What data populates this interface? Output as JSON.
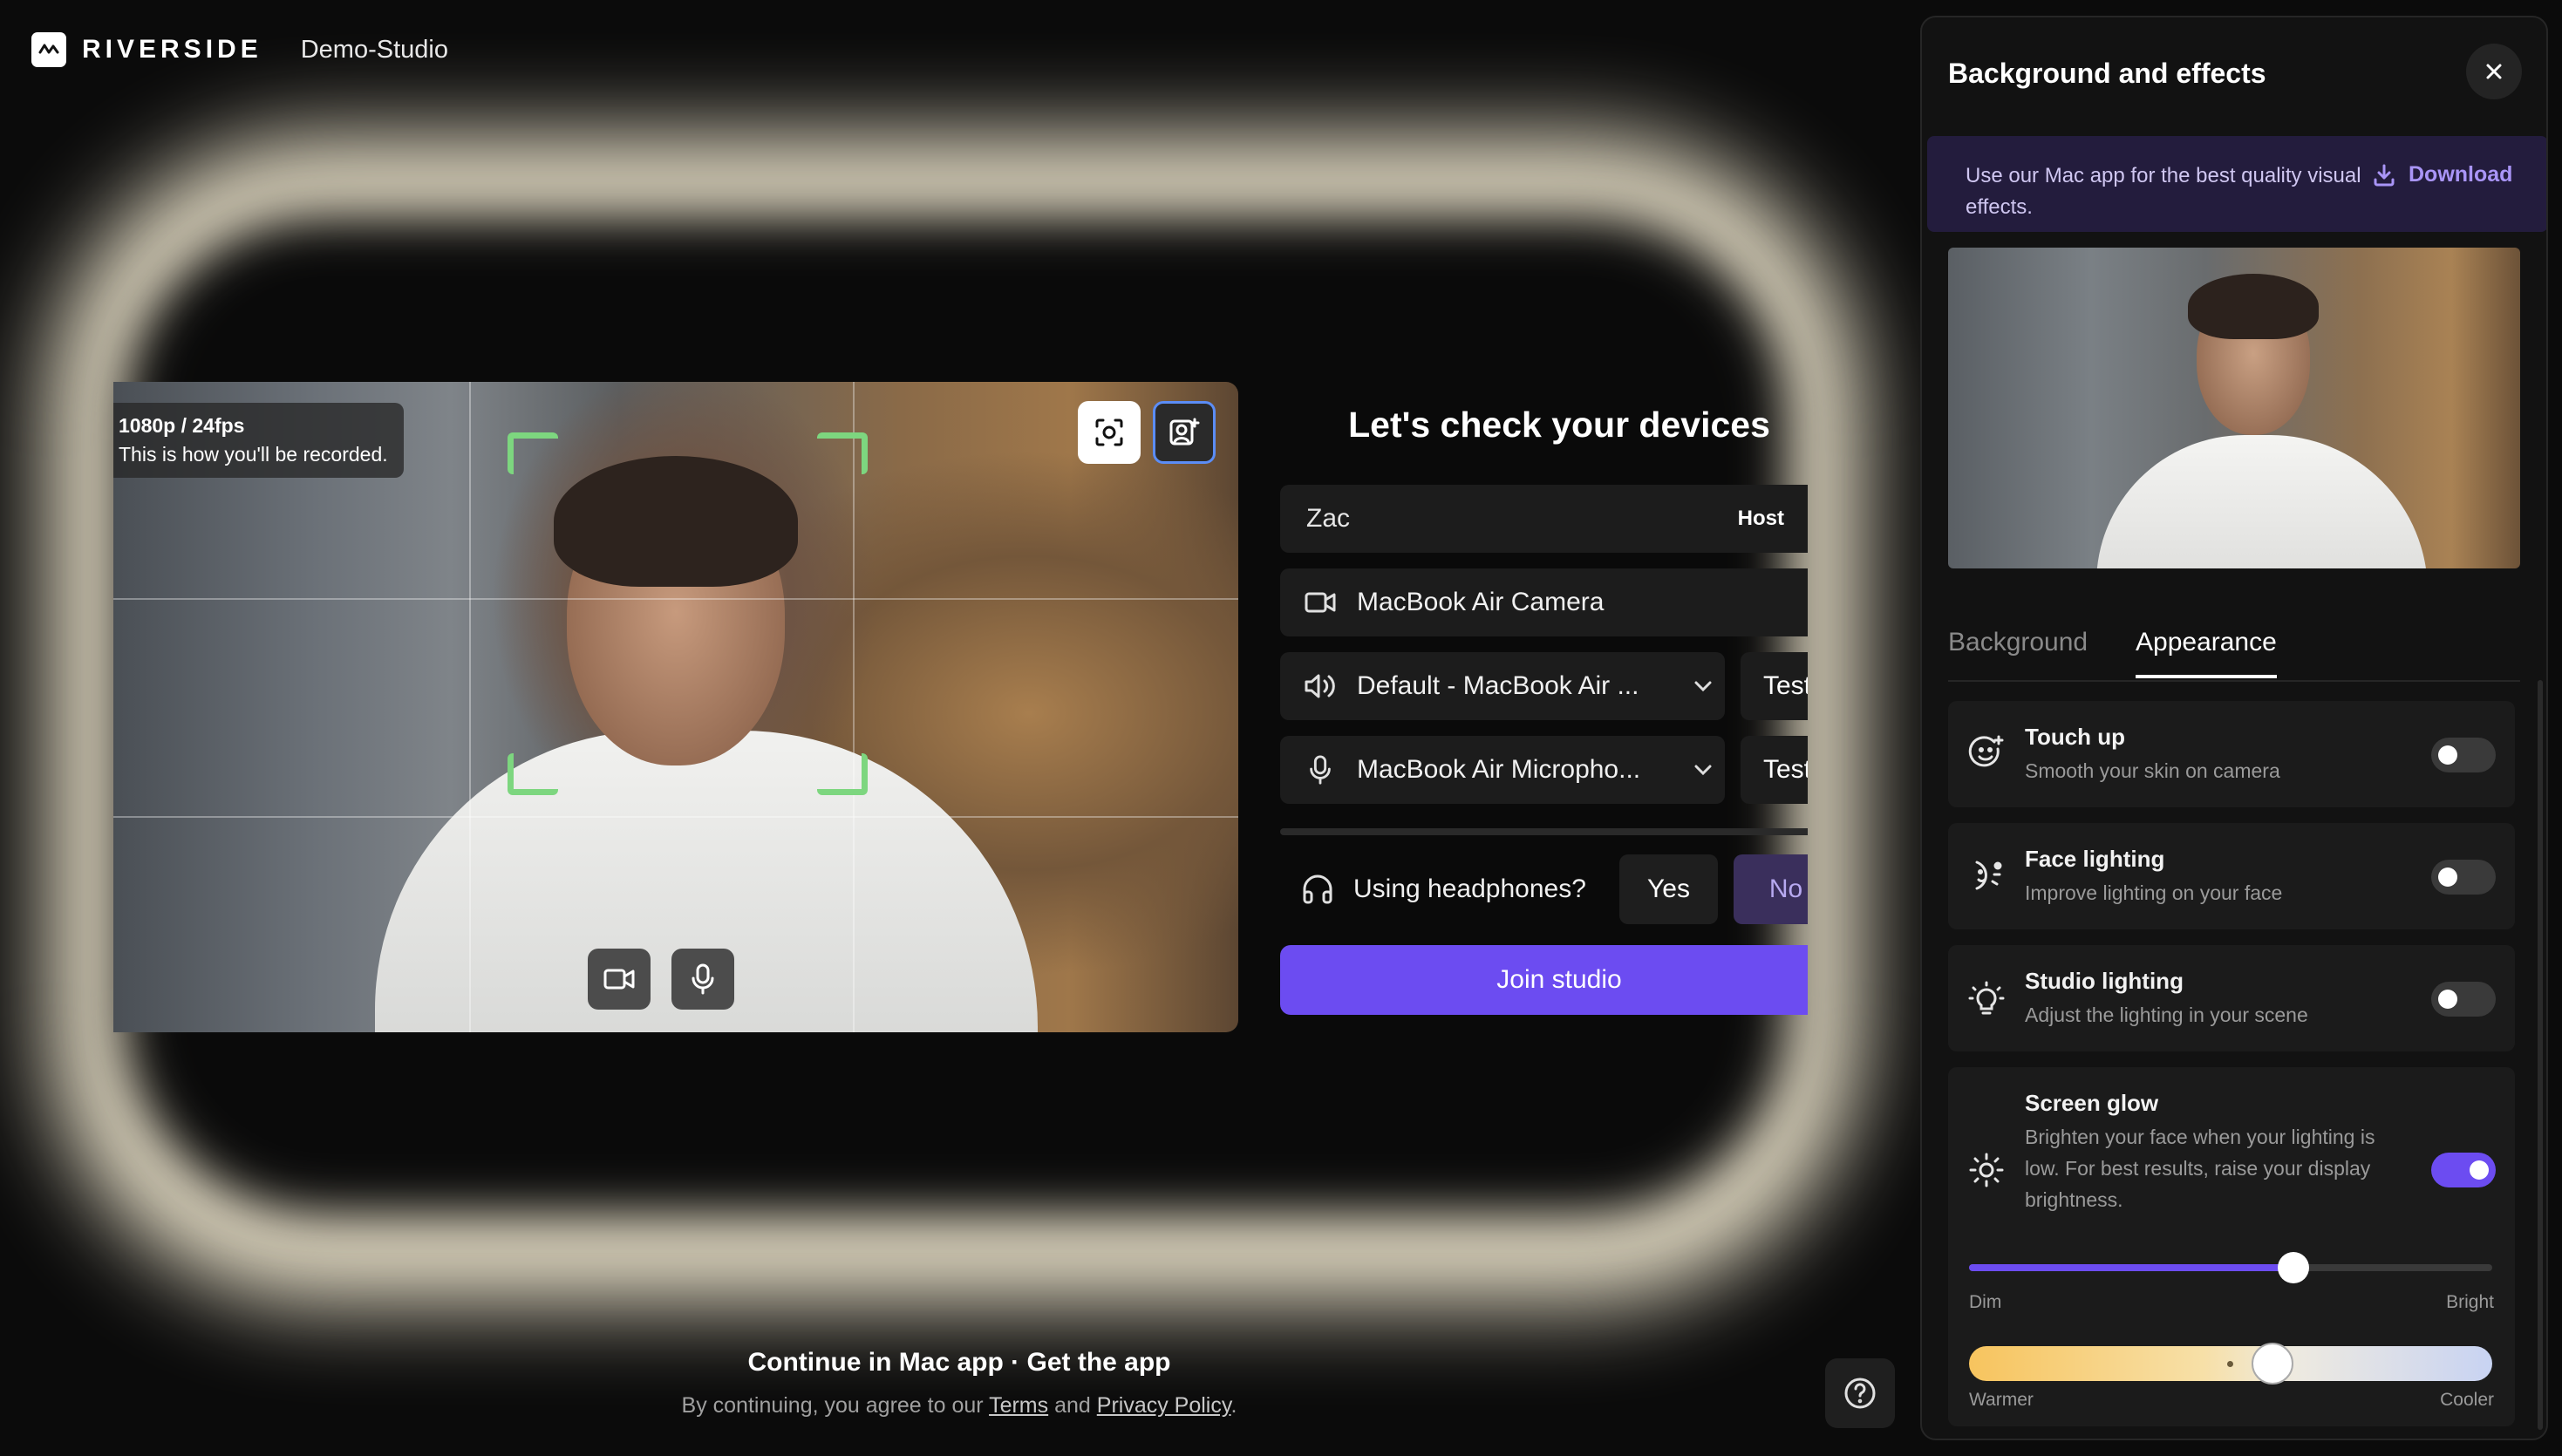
{
  "app": {
    "brand": "RIVERSIDE",
    "studio_name": "Demo-Studio"
  },
  "preview": {
    "resolution": "1080p / 24fps",
    "recording_note": "This is how you'll be recorded."
  },
  "devices": {
    "title": "Let's check your devices",
    "name_value": "Zac",
    "role": "Host",
    "camera": "MacBook Air Camera",
    "speaker": "Default - MacBook Air ...",
    "microphone": "MacBook Air Micropho...",
    "test_label": "Test",
    "headphones_question": "Using headphones?",
    "yes_label": "Yes",
    "no_label": "No",
    "join_label": "Join studio"
  },
  "footer": {
    "continue_text": "Continue in Mac app · Get the app",
    "agree_prefix": "By continuing, you agree to our",
    "terms": "Terms",
    "and": "and",
    "privacy": "Privacy Policy",
    "period": "."
  },
  "panel": {
    "title": "Background and effects",
    "banner_text": "Use our Mac app for the best quality visual effects.",
    "download_label": "Download",
    "tabs": [
      {
        "label": "Background",
        "active": false
      },
      {
        "label": "Appearance",
        "active": true
      }
    ],
    "effects": [
      {
        "title": "Touch up",
        "subtitle": "Smooth your skin on camera",
        "enabled": false
      },
      {
        "title": "Face lighting",
        "subtitle": "Improve lighting on your face",
        "enabled": false
      },
      {
        "title": "Studio lighting",
        "subtitle": "Adjust the lighting in your scene",
        "enabled": false
      },
      {
        "title": "Screen glow",
        "subtitle": "Brighten your face when your lighting is low. For best results, raise your display brightness.",
        "enabled": true
      }
    ],
    "brightness": {
      "min_label": "Dim",
      "max_label": "Bright",
      "value_fraction": 0.62
    },
    "temperature": {
      "min_label": "Warmer",
      "max_label": "Cooler",
      "value_fraction": 0.58
    }
  },
  "colors": {
    "accent": "#6c4cf1",
    "glow": "#fff6dc",
    "face_frame": "#7dd67f"
  }
}
